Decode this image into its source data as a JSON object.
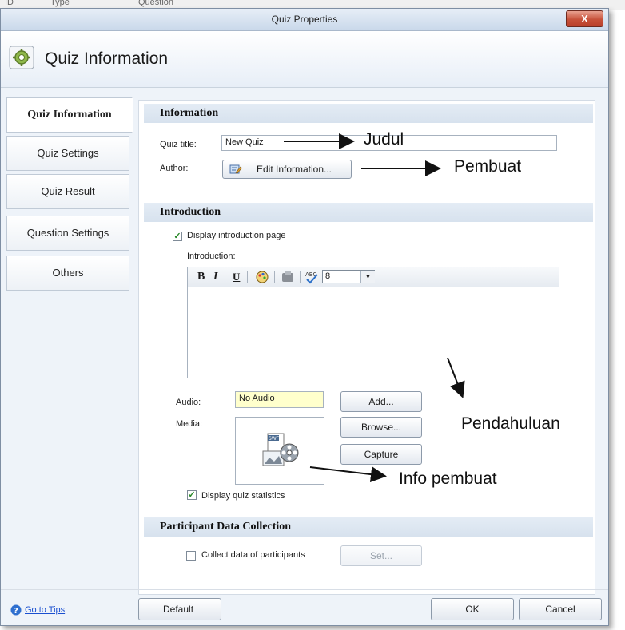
{
  "background_app": {
    "col_id": "ID",
    "col_type": "Type",
    "col_question": "Question"
  },
  "window": {
    "title": "Quiz Properties",
    "close_label": "X"
  },
  "header": {
    "title": "Quiz Information",
    "icon": "gear-settings-icon"
  },
  "tabs": [
    {
      "label": "Quiz Information",
      "active": true
    },
    {
      "label": "Quiz Settings",
      "active": false
    },
    {
      "label": "Quiz Result",
      "active": false
    },
    {
      "label": "Question Settings",
      "active": false
    },
    {
      "label": "Others",
      "active": false
    }
  ],
  "information": {
    "heading": "Information",
    "quiz_title_label": "Quiz title:",
    "quiz_title_value": "New Quiz",
    "author_label": "Author:",
    "edit_info_button": "Edit Information..."
  },
  "introduction": {
    "heading": "Introduction",
    "display_intro_label": "Display introduction page",
    "display_intro_checked": true,
    "intro_label": "Introduction:",
    "toolbar": {
      "bold": "B",
      "italic": "I",
      "underline": "U",
      "font_size": "8"
    },
    "audio_label": "Audio:",
    "audio_value": "No Audio",
    "add_button": "Add...",
    "media_label": "Media:",
    "browse_button": "Browse...",
    "capture_button": "Capture",
    "display_stats_label": "Display quiz statistics",
    "display_stats_checked": true
  },
  "participant": {
    "heading": "Participant Data Collection",
    "collect_label": "Collect data of participants",
    "collect_checked": false,
    "set_button": "Set..."
  },
  "footer": {
    "tips_link": "Go to Tips",
    "default_button": "Default",
    "ok_button": "OK",
    "cancel_button": "Cancel"
  },
  "annotations": {
    "judul": "Judul",
    "pembuat": "Pembuat",
    "pendahuluan": "Pendahuluan",
    "info_pembuat": "Info pembuat"
  },
  "colors": {
    "close_button": "#c7513a",
    "audio_field_bg": "#ffffcc",
    "section_bg": "#dde6f0",
    "check_mark": "#2a8a2a"
  }
}
